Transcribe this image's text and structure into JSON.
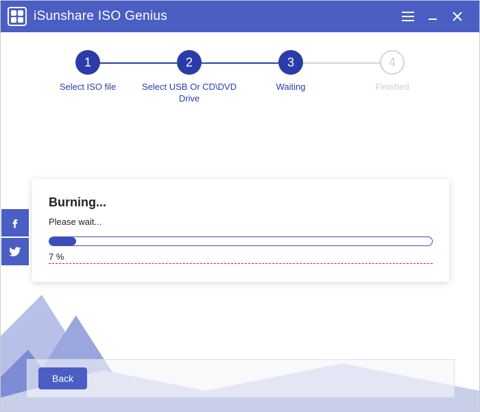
{
  "app": {
    "title": "iSunshare ISO Genius"
  },
  "steps": [
    {
      "num": "1",
      "label": "Select ISO file"
    },
    {
      "num": "2",
      "label": "Select USB Or CD\\DVD Drive"
    },
    {
      "num": "3",
      "label": "Waiting"
    },
    {
      "num": "4",
      "label": "Finished"
    }
  ],
  "card": {
    "title": "Burning...",
    "subtitle": "Please wait...",
    "percent_text": "7 %",
    "percent_value": 7
  },
  "footer": {
    "back_label": "Back"
  },
  "colors": {
    "accent": "#4a5ec4",
    "step": "#2b3ca8"
  }
}
